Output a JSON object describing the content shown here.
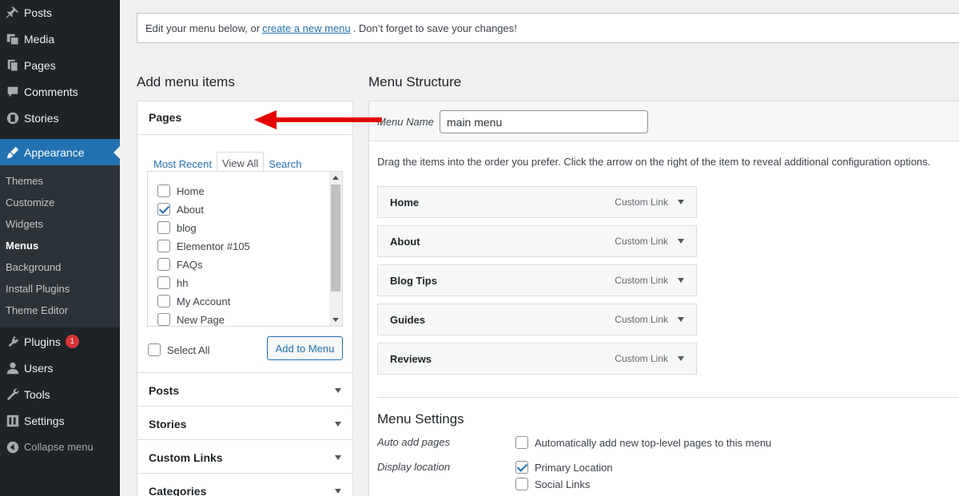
{
  "sidebar": {
    "top_items": [
      {
        "label": "Posts",
        "icon": "pin-icon"
      },
      {
        "label": "Media",
        "icon": "media-icon"
      },
      {
        "label": "Pages",
        "icon": "pages-icon"
      },
      {
        "label": "Comments",
        "icon": "comment-icon"
      },
      {
        "label": "Stories",
        "icon": "stories-icon"
      }
    ],
    "current": {
      "label": "Appearance",
      "icon": "brush-icon"
    },
    "submenu": [
      "Themes",
      "Customize",
      "Widgets",
      "Menus",
      "Background",
      "Install Plugins",
      "Theme Editor"
    ],
    "bottom_items": [
      {
        "label": "Plugins",
        "badge": "1"
      },
      {
        "label": "Users"
      },
      {
        "label": "Tools"
      },
      {
        "label": "Settings"
      }
    ],
    "collapse_label": "Collapse menu"
  },
  "notice": {
    "before": "Edit your menu below, or",
    "link": "create a new menu",
    "after": ". Don’t forget to save your changes!"
  },
  "add_items": {
    "title": "Add menu items",
    "pages_panel": {
      "title": "Pages",
      "tabs": [
        "Most Recent",
        "View All",
        "Search"
      ],
      "active_tab": "View All",
      "pages": [
        {
          "label": "Home",
          "checked": false
        },
        {
          "label": "About",
          "checked": true
        },
        {
          "label": "blog",
          "checked": false
        },
        {
          "label": "Elementor #105",
          "checked": false
        },
        {
          "label": "FAQs",
          "checked": false
        },
        {
          "label": "hh",
          "checked": false
        },
        {
          "label": "My Account",
          "checked": false
        },
        {
          "label": "New Page",
          "checked": false
        }
      ],
      "select_all_label": "Select All",
      "add_button_label": "Add to Menu"
    },
    "other_panels": [
      "Posts",
      "Stories",
      "Custom Links",
      "Categories"
    ]
  },
  "structure": {
    "title": "Menu Structure",
    "menu_name_label": "Menu Name",
    "menu_name_value": "main menu",
    "instructions": "Drag the items into the order you prefer. Click the arrow on the right of the item to reveal additional configuration options.",
    "items": [
      {
        "title": "Home",
        "type": "Custom Link"
      },
      {
        "title": "About",
        "type": "Custom Link"
      },
      {
        "title": "Blog Tips",
        "type": "Custom Link"
      },
      {
        "title": "Guides",
        "type": "Custom Link"
      },
      {
        "title": "Reviews",
        "type": "Custom Link"
      }
    ]
  },
  "settings": {
    "title": "Menu Settings",
    "auto_add_label": "Auto add pages",
    "auto_add_option": "Automatically add new top-level pages to this menu",
    "display_location_label": "Display location",
    "locations": [
      {
        "label": "Primary Location",
        "checked": true
      },
      {
        "label": "Social Links",
        "checked": false
      }
    ]
  },
  "colors": {
    "sidebar_bg": "#1d2327",
    "accent": "#2271b1",
    "annotation_arrow": "#e50000"
  }
}
